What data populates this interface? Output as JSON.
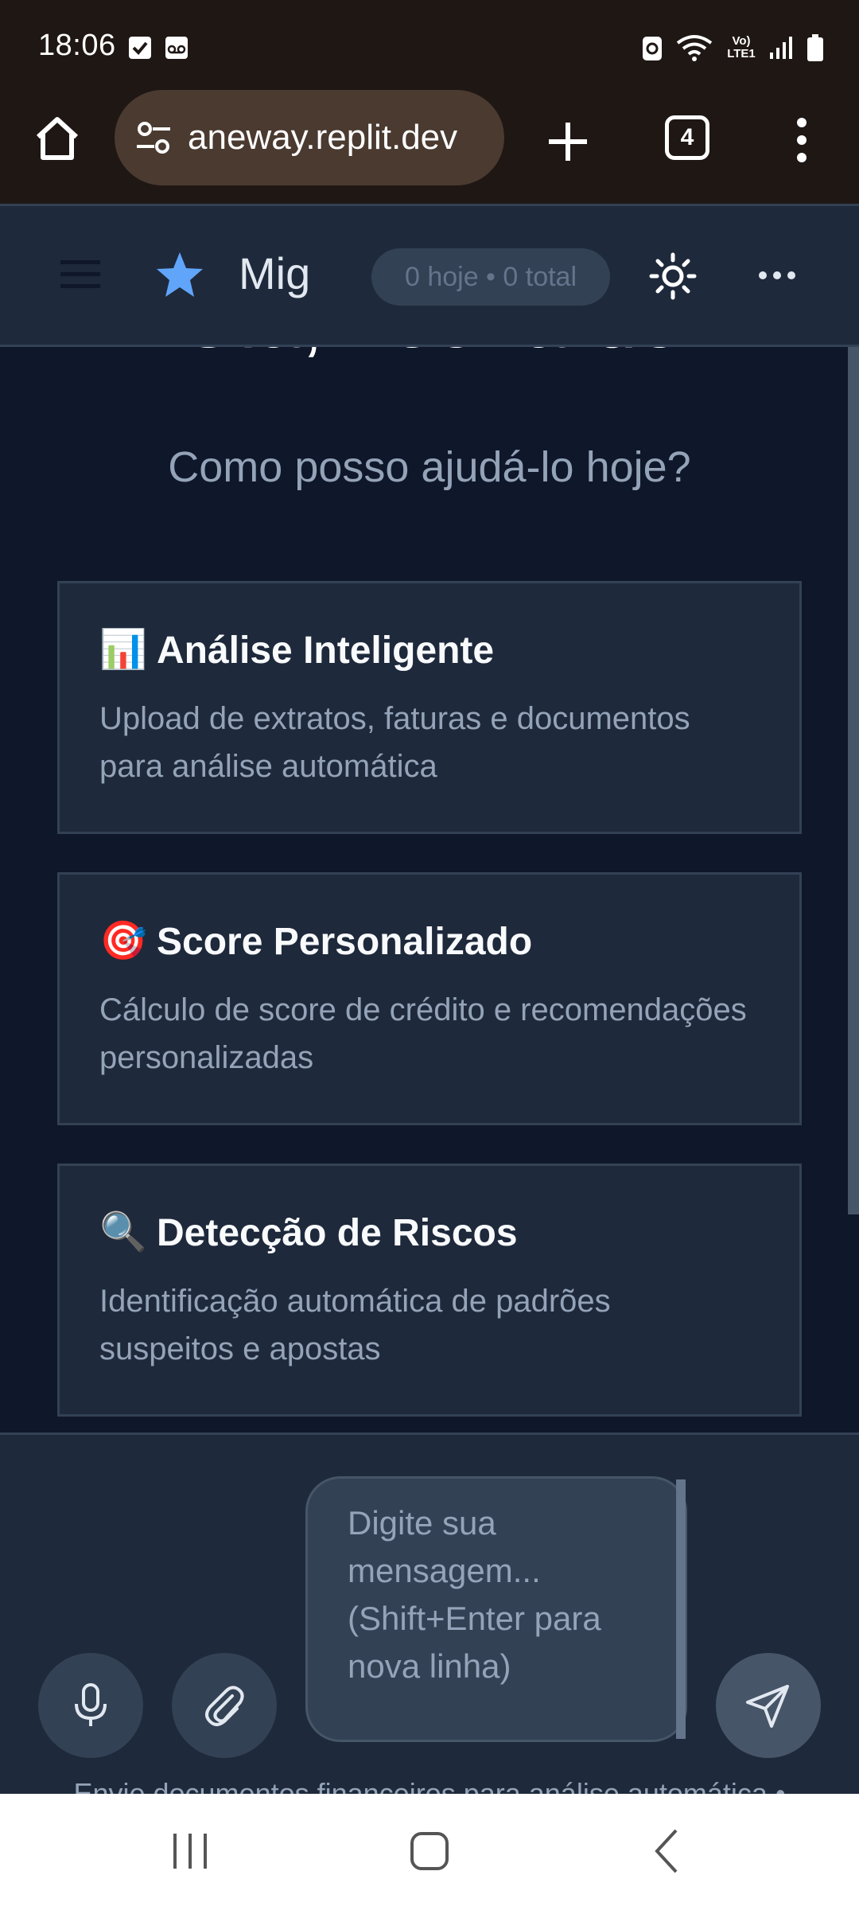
{
  "status_bar": {
    "time": "18:06",
    "network_label": "Vo) LTE1"
  },
  "browser": {
    "url": "aneway.replit.dev",
    "tab_count": "4"
  },
  "header": {
    "title": "Mig",
    "counter": "0 hoje • 0 total"
  },
  "main": {
    "greeting": "Olá, Leonardo",
    "subtitle": "Como posso ajudá-lo hoje?",
    "cards": [
      {
        "emoji": "📊",
        "title": "Análise Inteligente",
        "description": "Upload de extratos, faturas e documentos para análise automática"
      },
      {
        "emoji": "🎯",
        "title": "Score Personalizado",
        "description": "Cálculo de score de crédito e recomendações personalizadas"
      },
      {
        "emoji": "🔍",
        "title": "Detecção de Riscos",
        "description": "Identificação automática de padrões suspeitos e apostas"
      }
    ]
  },
  "composer": {
    "placeholder": "Digite sua mensagem... (Shift+Enter para nova linha)",
    "footer_note": "Envie documentos financeiros para análise automática •"
  },
  "colors": {
    "accent_star": "#60a5fa",
    "page_bg": "#0f172a",
    "card_bg": "#1e293b",
    "browser_bg": "#1f1714"
  }
}
